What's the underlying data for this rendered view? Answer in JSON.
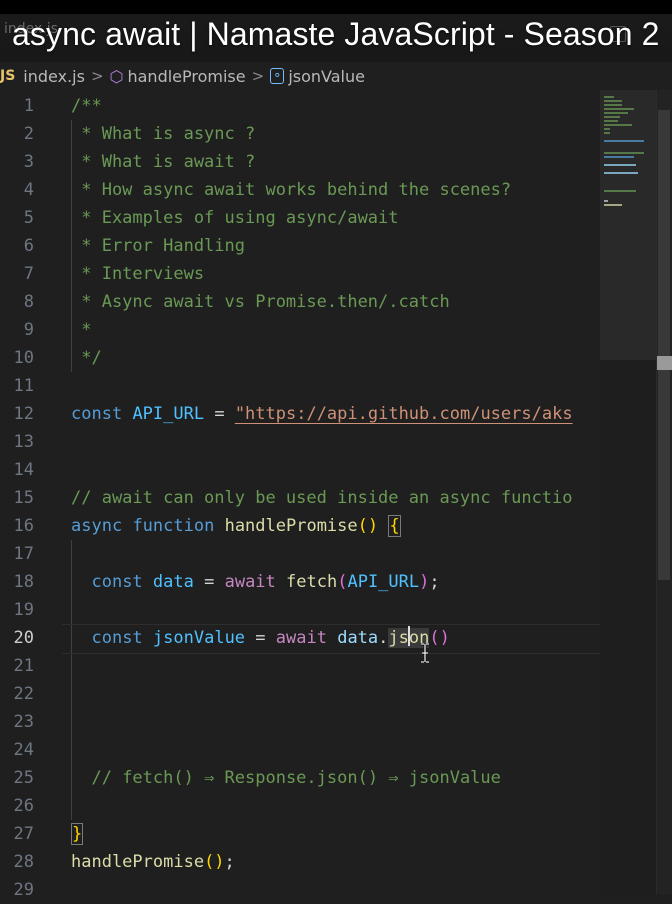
{
  "window": {
    "tab_label": "index.js",
    "video_title": "async await | Namaste JavaScript - Season 2"
  },
  "breadcrumb": {
    "lang_badge": "JS",
    "file": "index.js",
    "function": "handlePromise",
    "symbol": "jsonValue",
    "function_icon": "cube-icon",
    "symbol_icon": "variable-icon",
    "separator": ">"
  },
  "editor": {
    "active_line": 20,
    "line_numbers": [
      "1",
      "2",
      "3",
      "4",
      "5",
      "6",
      "7",
      "8",
      "9",
      "10",
      "11",
      "12",
      "13",
      "14",
      "15",
      "16",
      "17",
      "18",
      "19",
      "20",
      "21",
      "22",
      "23",
      "24",
      "25",
      "26",
      "27",
      "28",
      "29"
    ],
    "comment_block": {
      "open": "/**",
      "items": [
        " * What is async ?",
        " * What is await ?",
        " * How async await works behind the scenes?",
        " * Examples of using async/await",
        " * Error Handling",
        " * Interviews",
        " * Async await vs Promise.then/.catch",
        " *"
      ],
      "close": " */"
    },
    "line12": {
      "kw": "const",
      "name": "API_URL",
      "op": " = ",
      "value": "\"https://api.github.com/users/aks"
    },
    "line15": {
      "comment": "// await can only be used inside an async functio"
    },
    "line16": {
      "kw1": "async",
      "kw2": "function",
      "name": "handlePromise",
      "paren": "()",
      "brace": "{"
    },
    "line18": {
      "kw": "const",
      "name": "data",
      "op": " = ",
      "await": "await",
      "fn": "fetch",
      "lp": "(",
      "arg": "API_URL",
      "rp": ")",
      "semi": ";"
    },
    "line20": {
      "kw": "const",
      "name": "jsonValue",
      "op": " = ",
      "await": "await",
      "obj": "data",
      "dot": ".",
      "fn_a": "js",
      "fn_b": "on",
      "paren": "()"
    },
    "line25": {
      "comment": "// fetch() ⇒ Response.json() ⇒ jsonValue"
    },
    "line27": {
      "brace": "}"
    },
    "line28": {
      "fn": "handlePromise",
      "paren": "()",
      "semi": ";"
    }
  },
  "colors": {
    "background": "#1f1f1f",
    "comment": "#6a9955",
    "keyword": "#569cd6",
    "function": "#dcdcaa",
    "string": "#ce9178",
    "control": "#c586c0"
  }
}
